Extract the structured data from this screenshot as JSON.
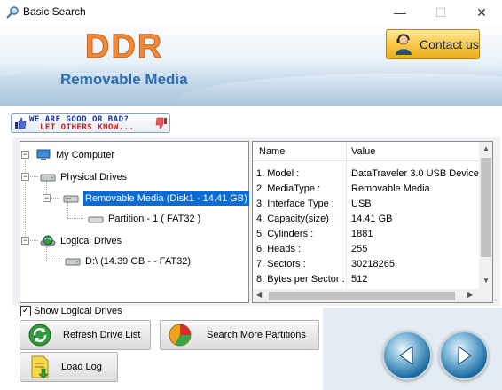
{
  "window": {
    "title": "Basic Search",
    "min_glyph": "—",
    "max_glyph": "☐",
    "close_glyph": "✕"
  },
  "banner": {
    "logo": "DDR",
    "product": "Removable Media",
    "contact_label": "Contact us"
  },
  "feedback": {
    "line1": "WE ARE GOOD OR BAD?",
    "line2": "LET OTHERS KNOW..."
  },
  "tree": {
    "root": "My Computer",
    "physical": "Physical Drives",
    "removable": "Removable Media (Disk1 - 14.41 GB)",
    "partition": "Partition - 1 ( FAT32 )",
    "logical": "Logical Drives",
    "logical_drive": "D:\\ (14.39 GB -  - FAT32)",
    "expanded_glyph": "−"
  },
  "properties": {
    "headers": {
      "name": "Name",
      "value": "Value"
    },
    "rows": [
      {
        "name": "1. Model :",
        "value": "DataTraveler 3.0 USB Device"
      },
      {
        "name": "2. MediaType :",
        "value": "Removable Media"
      },
      {
        "name": "3. Interface Type :",
        "value": "USB"
      },
      {
        "name": "4. Capacity(size) :",
        "value": "14.41 GB"
      },
      {
        "name": "5. Cylinders :",
        "value": "1881"
      },
      {
        "name": "6. Heads :",
        "value": "255"
      },
      {
        "name": "7. Sectors :",
        "value": "30218265"
      },
      {
        "name": "8. Bytes per Sector :",
        "value": "512"
      }
    ]
  },
  "options": {
    "show_logical_label": "Show Logical Drives",
    "show_logical_checked": "✓"
  },
  "buttons": {
    "refresh": "Refresh Drive List",
    "search_more": "Search More Partitions",
    "load_log": "Load Log"
  },
  "icons": {
    "app": "search-app-icon",
    "contact": "person-headset-icon",
    "refresh": "refresh-arrows-icon",
    "search": "pie-chart-icon",
    "load": "document-arrow-icon",
    "back": "back-arrow-icon",
    "next": "next-arrow-icon"
  },
  "colors": {
    "accent": "#0a6ad6",
    "logo": "#f08a3a",
    "product": "#2a6db3",
    "contact_bg": "#f7c94a"
  }
}
